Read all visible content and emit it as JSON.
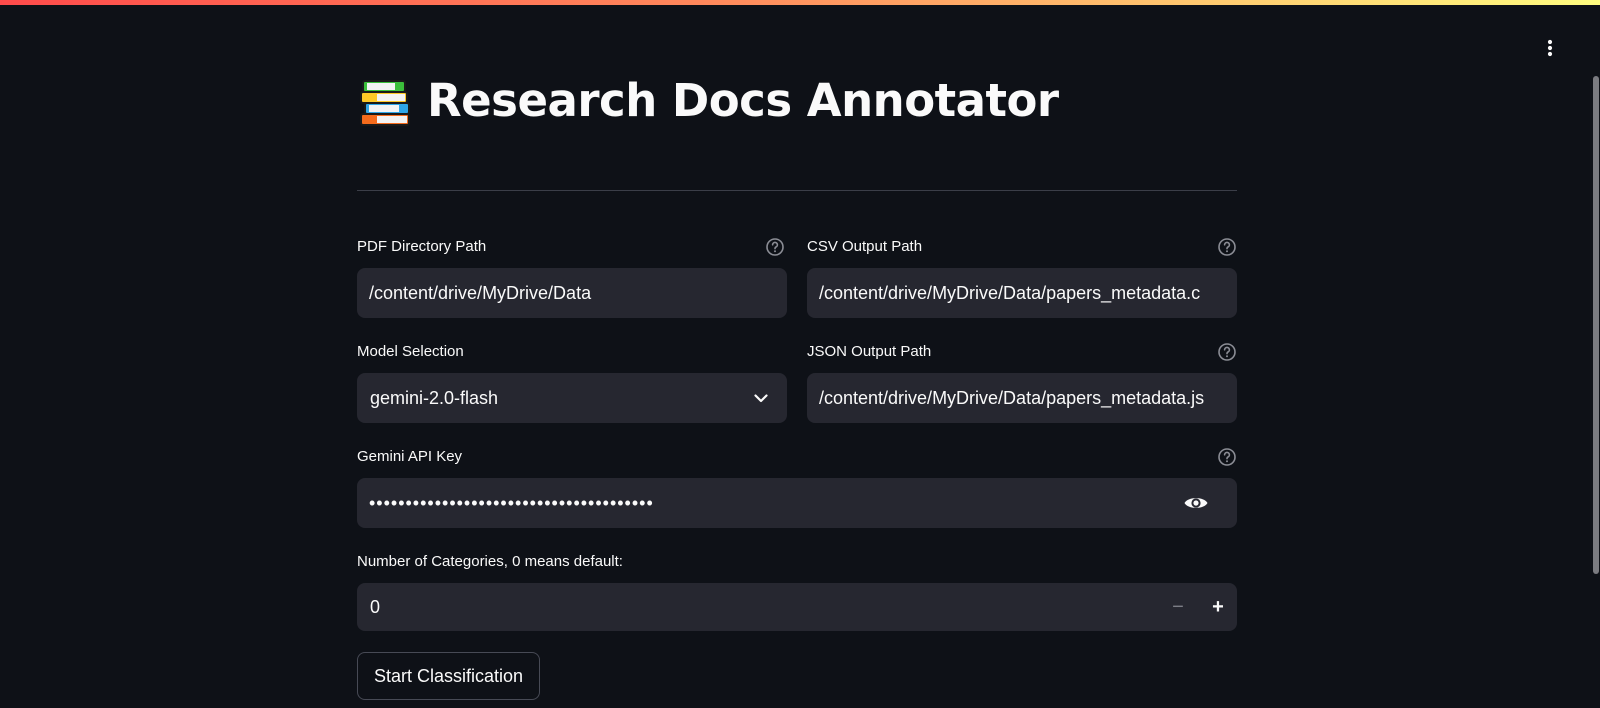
{
  "app": {
    "title": "Research Docs Annotator",
    "title_icon": "books-icon",
    "menu_icon": "vertical-ellipsis-icon"
  },
  "fields": {
    "pdf_dir": {
      "label": "PDF Directory Path",
      "value": "/content/drive/MyDrive/Data",
      "has_help": true
    },
    "csv_output": {
      "label": "CSV Output Path",
      "value": "/content/drive/MyDrive/Data/papers_metadata.c",
      "has_help": true
    },
    "model_selection": {
      "label": "Model Selection",
      "selected": "gemini-2.0-flash"
    },
    "json_output": {
      "label": "JSON Output Path",
      "value": "/content/drive/MyDrive/Data/papers_metadata.js",
      "has_help": true
    },
    "api_key": {
      "label": "Gemini API Key",
      "masked_value": "•••••••••••••••••••••••••••••••••••••••",
      "has_help": true,
      "reveal_icon": "eye-icon"
    },
    "num_categories": {
      "label": "Number of Categories, 0 means default:",
      "value": "0",
      "decrement_label": "−",
      "increment_label": "+"
    }
  },
  "actions": {
    "start_label": "Start Classification"
  },
  "colors": {
    "background": "#0e1117",
    "input_background": "#262730",
    "text": "#fafafa",
    "help_icon": "#8b8d95",
    "divider": "#3b3e48"
  }
}
